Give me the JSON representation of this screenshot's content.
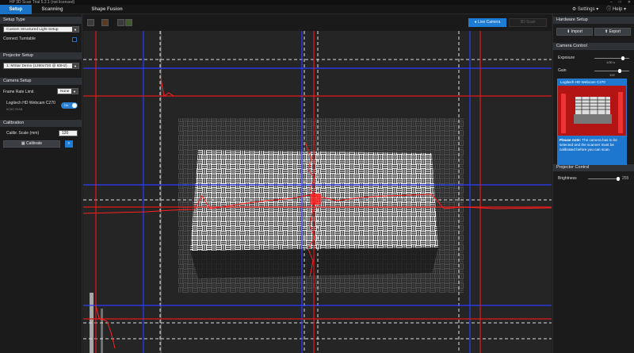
{
  "window": {
    "title": "HP 3D Scan Trial 5.2.1 (not licensed)"
  },
  "menubar": {
    "tabs": [
      {
        "label": "Setup",
        "active": true
      },
      {
        "label": "Scanning",
        "active": false
      },
      {
        "label": "Shape Fusion",
        "active": false
      }
    ],
    "settings_label": "Settings",
    "help_label": "Help"
  },
  "left": {
    "setup_type": {
      "header": "Setup Type",
      "selected": "Custom Structured Light Setup",
      "turntable_label": "Connect Turntable"
    },
    "projector_setup": {
      "header": "Projector Setup",
      "selected": "1: MStar Demo (1280x720 @ 60Hz)"
    },
    "camera_setup": {
      "header": "Camera Setup",
      "frame_rate_label": "Frame Rate Limit",
      "frame_rate_value": "None",
      "camera_name": "Logitech HD Webcam C270",
      "camera_serial": "5C8C7EAB",
      "toggle_label": "On"
    },
    "calibration": {
      "header": "Calibration",
      "scale_label": "Calibr. Scale (mm)",
      "scale_value": "120",
      "calibrate_label": "Calibrate"
    }
  },
  "viewer": {
    "live_camera_label": "Live Camera",
    "scan_3d_label": "3D Scan"
  },
  "right": {
    "hardware_setup": {
      "header": "Hardware Setup",
      "import_label": "Import",
      "export_label": "Export"
    },
    "camera_control": {
      "header": "Camera Control",
      "exposure_label": "Exposure",
      "exposure_value": "1/30 s",
      "exposure_level": 0.85,
      "gain_label": "Gain",
      "gain_value": "192",
      "gain_level": 0.75,
      "preview_label": "Logitech HD Webcam C270",
      "note_bold": "Please note:",
      "note_text": "The camera has to be selected and the scanner must be calibrated before you can scan."
    },
    "projector_control": {
      "header": "Projector Control",
      "brightness_label": "Brightness",
      "brightness_value": "255",
      "brightness_level": 1.0
    }
  },
  "colors": {
    "accent": "#1d7dd6",
    "overlay_red": "#e01818",
    "overlay_blue": "#2233ff"
  }
}
